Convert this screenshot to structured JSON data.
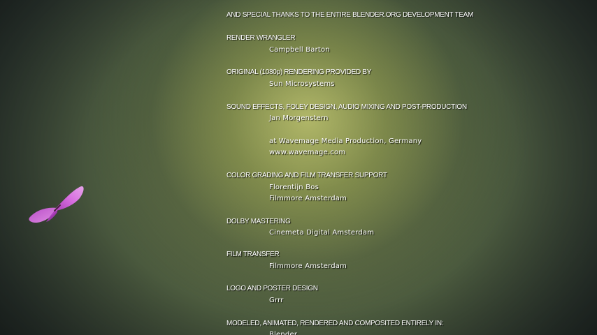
{
  "credits": [
    {
      "type": "head",
      "text": "AND SPECIAL THANKS TO THE ENTIRE BLENDER.ORG DEVELOPMENT TEAM"
    },
    {
      "type": "head",
      "text": "RENDER WRANGLER"
    },
    {
      "type": "name",
      "text": "Campbell Barton"
    },
    {
      "type": "head",
      "text": "ORIGINAL (1080p) RENDERING PROVIDED BY"
    },
    {
      "type": "name",
      "text": "Sun Microsystems"
    },
    {
      "type": "head",
      "text": "SOUND EFFECTS, FOLEY DESIGN, AUDIO MIXING AND POST-PRODUCTION"
    },
    {
      "type": "name",
      "text": "Jan Morgenstern"
    },
    {
      "type": "name",
      "text": "at Wavemage Media Production, Germany"
    },
    {
      "type": "name",
      "text": "www.wavemage.com"
    },
    {
      "type": "head",
      "text": "COLOR GRADING AND FILM TRANSFER SUPPORT"
    },
    {
      "type": "name",
      "text": "Florentijn Bos"
    },
    {
      "type": "name",
      "text": "Filmmore Amsterdam"
    },
    {
      "type": "head",
      "text": "DOLBY MASTERING"
    },
    {
      "type": "name",
      "text": "Cinemeta Digital Amsterdam"
    },
    {
      "type": "head",
      "text": "FILM TRANSFER"
    },
    {
      "type": "name",
      "text": "Filmmore Amsterdam"
    },
    {
      "type": "head",
      "text": "LOGO AND POSTER DESIGN"
    },
    {
      "type": "name",
      "text": "Grrr"
    },
    {
      "type": "head",
      "text": "MODELED, ANIMATED, RENDERED AND COMPOSITED ENTIRELY IN:"
    },
    {
      "type": "name",
      "text": "Blender"
    }
  ],
  "icons": {
    "butterfly": "butterfly-icon"
  },
  "colors": {
    "text": "#ffffff",
    "butterfly": "#d060d8"
  }
}
